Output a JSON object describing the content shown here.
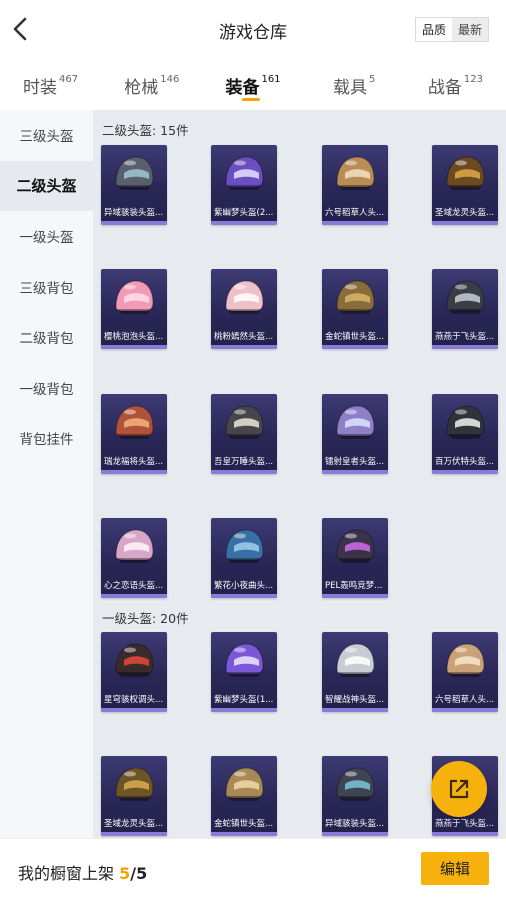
{
  "header": {
    "title": "游戏仓库",
    "sort_quality": "品质",
    "sort_latest": "最新",
    "back_icon": "chevron-left-icon"
  },
  "tabs": [
    {
      "label": "时装",
      "count": "467",
      "active": false
    },
    {
      "label": "枪械",
      "count": "146",
      "active": false
    },
    {
      "label": "装备",
      "count": "161",
      "active": true
    },
    {
      "label": "载具",
      "count": "5",
      "active": false
    },
    {
      "label": "战备",
      "count": "123",
      "active": false
    }
  ],
  "sidebar": {
    "items": [
      {
        "label": "三级头盔",
        "active": false
      },
      {
        "label": "二级头盔",
        "active": true
      },
      {
        "label": "一级头盔",
        "active": false
      },
      {
        "label": "三级背包",
        "active": false
      },
      {
        "label": "二级背包",
        "active": false
      },
      {
        "label": "一级背包",
        "active": false
      },
      {
        "label": "背包挂件",
        "active": false
      }
    ]
  },
  "sections": [
    {
      "title": "二级头盔: 15件",
      "items": [
        {
          "name": "异域骇装头盔...",
          "icon": "helmet-icon",
          "color": "#5a5f6e",
          "accent": "#9ec9d6"
        },
        {
          "name": "紫幽梦头盔(2...",
          "icon": "helmet-icon",
          "color": "#6a4fc0",
          "accent": "#e7e2ff"
        },
        {
          "name": "六号稻草人头...",
          "icon": "helmet-icon",
          "color": "#b98d55",
          "accent": "#f1e3c2"
        },
        {
          "name": "圣域龙灵头盔...",
          "icon": "helmet-icon",
          "color": "#6b4a21",
          "accent": "#e0a847"
        },
        {
          "name": "樱桃泡泡头盔...",
          "icon": "helmet-icon",
          "color": "#f09ab5",
          "accent": "#ffe0ea"
        },
        {
          "name": "桃粉嫣然头盔...",
          "icon": "helmet-icon",
          "color": "#f0c0c8",
          "accent": "#ffffff"
        },
        {
          "name": "金蛇镇世头盔...",
          "icon": "helmet-icon",
          "color": "#8a6b3a",
          "accent": "#d9b66b"
        },
        {
          "name": "燕燕于飞头盔...",
          "icon": "helmet-icon",
          "color": "#3b3d46",
          "accent": "#c8ccd8"
        },
        {
          "name": "瑞龙福将头盔...",
          "icon": "helmet-icon",
          "color": "#b0523a",
          "accent": "#f3b679"
        },
        {
          "name": "吾皇万睡头盔...",
          "icon": "helmet-icon",
          "color": "#45454a",
          "accent": "#e9e6d8"
        },
        {
          "name": "镭射皇者头盔...",
          "icon": "helmet-icon",
          "color": "#8f7fc9",
          "accent": "#dde4ff"
        },
        {
          "name": "百万伏特头盔...",
          "icon": "helmet-icon",
          "color": "#30333b",
          "accent": "#f2f2f2"
        },
        {
          "name": "心之恋语头盔...",
          "icon": "helmet-icon",
          "color": "#d8a6c8",
          "accent": "#fff4f7"
        },
        {
          "name": "繁花小夜曲头...",
          "icon": "helmet-icon",
          "color": "#3a6fa5",
          "accent": "#9fd0f0"
        },
        {
          "name": "PEL轰鸣竞梦...",
          "icon": "helmet-icon",
          "color": "#3a3448",
          "accent": "#d26cf0"
        }
      ]
    },
    {
      "title": "一级头盔: 20件",
      "items": [
        {
          "name": "星穹骇权调头...",
          "icon": "helmet-icon",
          "color": "#3b2a2a",
          "accent": "#e84a3a"
        },
        {
          "name": "紫幽梦头盔(1...",
          "icon": "helmet-icon",
          "color": "#7a58d8",
          "accent": "#efe9ff"
        },
        {
          "name": "智耀战神头盔...",
          "icon": "helmet-icon",
          "color": "#c9ccd2",
          "accent": "#ffffff"
        },
        {
          "name": "六号稻草人头...",
          "icon": "helmet-icon",
          "color": "#cba177",
          "accent": "#f5e6cd"
        },
        {
          "name": "圣域龙灵头盔...",
          "icon": "helmet-icon",
          "color": "#6f5526",
          "accent": "#d8ae55"
        },
        {
          "name": "金蛇镇世头盔...",
          "icon": "helmet-icon",
          "color": "#a88a56",
          "accent": "#f0dba8"
        },
        {
          "name": "异域骇装头盔...",
          "icon": "helmet-icon",
          "color": "#3e4452",
          "accent": "#7fc3d8"
        },
        {
          "name": "燕燕于飞头盔...",
          "icon": "helmet-icon",
          "color": "#b99a74",
          "accent": "#efe2cc"
        }
      ]
    }
  ],
  "fab": {
    "icon": "share-external-icon"
  },
  "footer": {
    "label": "我的橱窗上架",
    "current": "5",
    "separator": "/",
    "max": "5",
    "edit_label": "编辑"
  },
  "colors": {
    "accent": "#f5a300",
    "card_top": "#3e3a74",
    "card_bottom": "#23214b",
    "card_stripe": "#8b7bd8"
  }
}
